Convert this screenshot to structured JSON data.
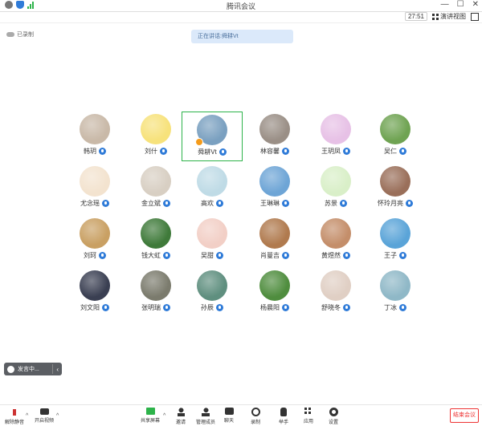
{
  "window": {
    "title": "腾讯会议"
  },
  "toolbar": {
    "timer": "27:51",
    "view_label": "演讲视图"
  },
  "recording": {
    "label": "已录制"
  },
  "notice": {
    "text": "正在讲话:舜耕Vt"
  },
  "participants": [
    {
      "name": "韩玥",
      "bg": "#c9b9a8"
    },
    {
      "name": "刘什",
      "bg": "#f7e27b"
    },
    {
      "name": "舜耕Vt",
      "bg": "#7aa0c0",
      "active": true
    },
    {
      "name": "林容馨",
      "bg": "#9a8f86"
    },
    {
      "name": "王玥凤",
      "bg": "#e7c1e6"
    },
    {
      "name": "吴仁",
      "bg": "#6fa352"
    },
    {
      "name": "尤念瑶",
      "bg": "#f3e3cf"
    },
    {
      "name": "金立斌",
      "bg": "#d8cfc3"
    },
    {
      "name": "高欢",
      "bg": "#bfdbe6"
    },
    {
      "name": "王琳琳",
      "bg": "#6ea5d6"
    },
    {
      "name": "苏景",
      "bg": "#d9efc8"
    },
    {
      "name": "怀玲月亮",
      "bg": "#9a6f5a"
    },
    {
      "name": "刘珂",
      "bg": "#c9a063"
    },
    {
      "name": "钱大虹",
      "bg": "#3f7a3a"
    },
    {
      "name": "吴甜",
      "bg": "#f2cfc6"
    },
    {
      "name": "肖曼吉",
      "bg": "#b07a4e"
    },
    {
      "name": "黄煜然",
      "bg": "#c48e6a"
    },
    {
      "name": "王子",
      "bg": "#5aa4d8"
    },
    {
      "name": "刘文阳",
      "bg": "#3a3f52"
    },
    {
      "name": "张明瑞",
      "bg": "#7b7b6d"
    },
    {
      "name": "孙辰",
      "bg": "#5f8f7f"
    },
    {
      "name": "杨晨阳",
      "bg": "#4f8d3e"
    },
    {
      "name": "舒晓冬",
      "bg": "#e0cfc4"
    },
    {
      "name": "丁冰",
      "bg": "#8fb8c7"
    }
  ],
  "chat": {
    "label": "发言中..."
  },
  "bottom": {
    "mute": "解除静音",
    "video": "开启视频",
    "share": "共享屏幕",
    "invite": "邀请",
    "members": "管理成员",
    "chat": "聊天",
    "record": "录制",
    "raise": "举手",
    "apps": "应用",
    "settings": "设置",
    "end": "结束会议"
  }
}
